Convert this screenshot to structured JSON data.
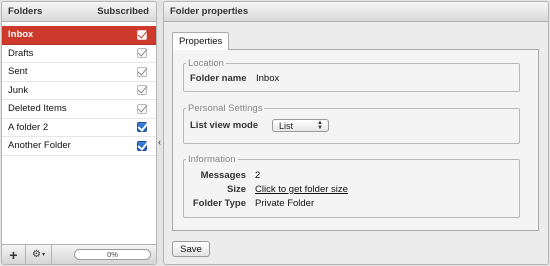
{
  "folders_panel": {
    "header_title": "Folders",
    "header_subscribed": "Subscribed",
    "items": [
      {
        "name": "Inbox",
        "subscribed": true,
        "selected": true,
        "editable": false
      },
      {
        "name": "Drafts",
        "subscribed": true,
        "selected": false,
        "editable": false
      },
      {
        "name": "Sent",
        "subscribed": true,
        "selected": false,
        "editable": false
      },
      {
        "name": "Junk",
        "subscribed": true,
        "selected": false,
        "editable": false
      },
      {
        "name": "Deleted Items",
        "subscribed": true,
        "selected": false,
        "editable": false
      },
      {
        "name": "A folder 2",
        "subscribed": true,
        "selected": false,
        "editable": true
      },
      {
        "name": "Another Folder",
        "subscribed": true,
        "selected": false,
        "editable": true
      }
    ],
    "footer": {
      "add_label": "+",
      "actions_label": "⚙",
      "actions_caret": "▾",
      "quota": "0%"
    },
    "splitter_glyph": "‹"
  },
  "properties_panel": {
    "header_title": "Folder properties",
    "tab_label": "Properties",
    "location": {
      "legend": "Location",
      "folder_name_label": "Folder name",
      "folder_name_value": "Inbox"
    },
    "personal": {
      "legend": "Personal Settings",
      "list_view_mode_label": "List view mode",
      "list_view_mode_value": "List"
    },
    "information": {
      "legend": "Information",
      "messages_label": "Messages",
      "messages_value": "2",
      "size_label": "Size",
      "size_link": "Click to get folder size",
      "type_label": "Folder Type",
      "type_value": "Private Folder"
    },
    "save_label": "Save"
  },
  "colors": {
    "selected_row": "#cd3a2c",
    "checkbox_on": "#1f5fb8"
  }
}
